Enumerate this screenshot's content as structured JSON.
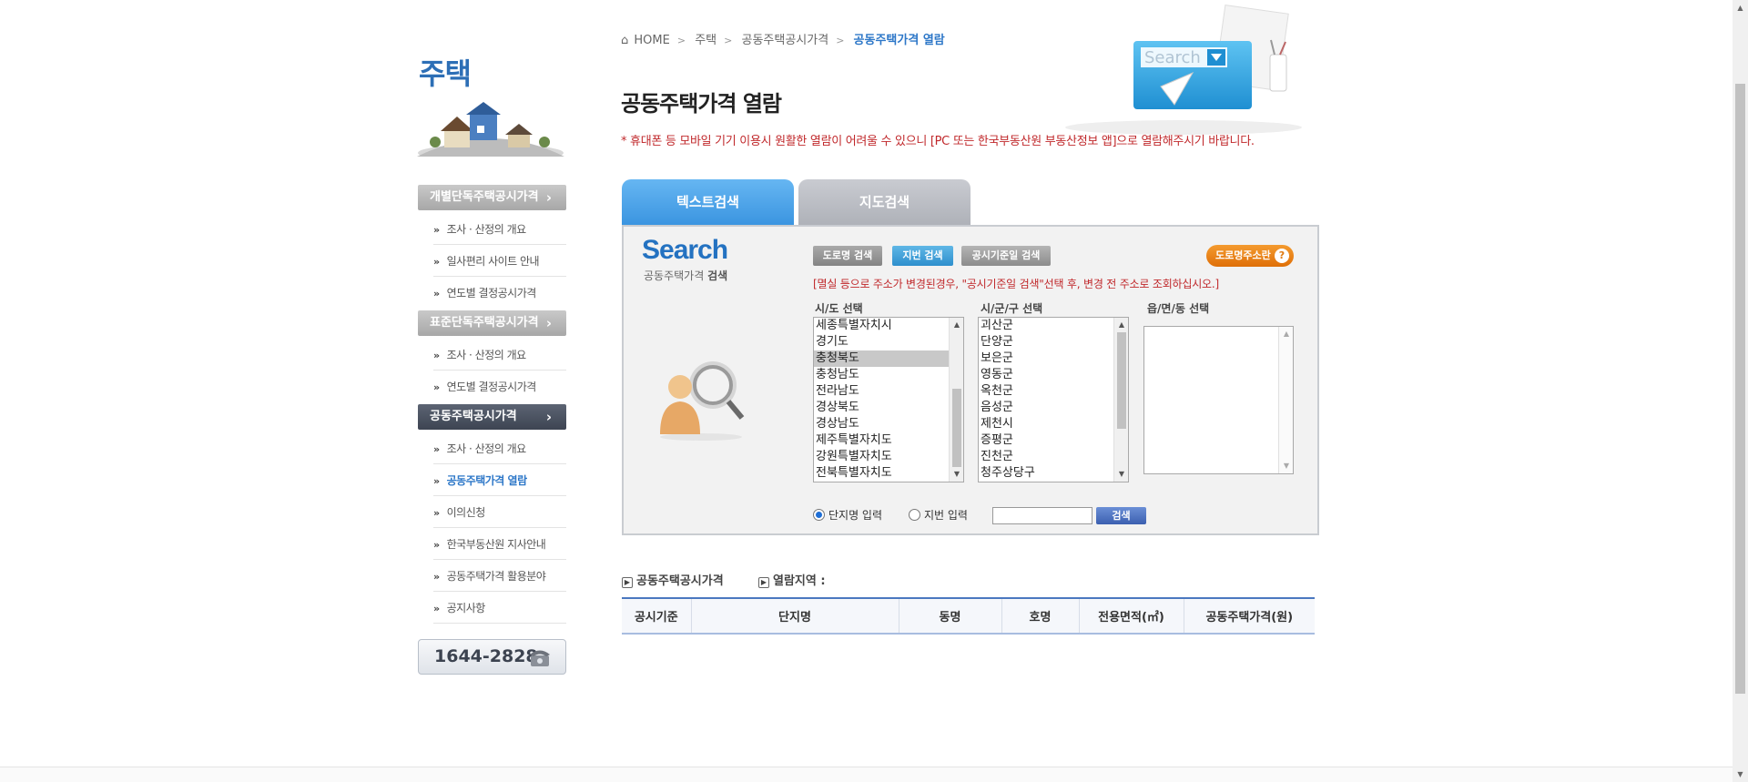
{
  "sidebar": {
    "title": "주택",
    "sections": [
      {
        "label": "개별단독주택공시가격",
        "items": [
          "조사 · 산정의 개요",
          "일사편리 사이트 안내",
          "연도별 결정공시가격"
        ]
      },
      {
        "label": "표준단독주택공시가격",
        "items": [
          "조사 · 산정의 개요",
          "연도별 결정공시가격"
        ]
      },
      {
        "label": "공동주택공시가격",
        "items": [
          "조사 · 산정의 개요",
          "공동주택가격 열람",
          "이의신청",
          "한국부동산원 지사안내",
          "공동주택가격 활용분야",
          "공지사항"
        ]
      }
    ],
    "bullet": "»",
    "chevron": "›",
    "phone": "1644-2828"
  },
  "breadcrumb": [
    "HOME",
    "주택",
    "공동주택공시가격",
    "공동주택가격 열람"
  ],
  "header_illus_text": "Search",
  "page": {
    "title": "공동주택가격 열람",
    "notice": "* 휴대폰 등 모바일 기기 이용시 원활한 열람이 어려울 수 있으니 [PC 또는 한국부동산원 부동산정보 앱]으로 열람해주시기 바랍니다."
  },
  "tabs": [
    "텍스트검색",
    "지도검색"
  ],
  "search": {
    "logo": "Search",
    "subtitle_plain": "공동주택가격 ",
    "subtitle_bold": "검색",
    "buttons": [
      "도로명 검색",
      "지번 검색",
      "공시기준일 검색"
    ],
    "guide_button": "도로명주소란",
    "guide_q": "?",
    "note": "[멸실 등으로 주소가 변경된경우, \"공시기준일 검색\"선택 후, 변경 전 주소로 조회하십시오.]",
    "col_labels": [
      "시/도 선택",
      "시/군/구 선택",
      "읍/면/동 선택"
    ],
    "sido_options": [
      "세종특별자치시",
      "경기도",
      "충청북도",
      "충청남도",
      "전라남도",
      "경상북도",
      "경상남도",
      "제주특별자치도",
      "강원특별자치도",
      "전북특별자치도"
    ],
    "sido_selected": "충청북도",
    "sigungu_options": [
      "괴산군",
      "단양군",
      "보은군",
      "영동군",
      "옥천군",
      "음성군",
      "제천시",
      "증평군",
      "진천군",
      "청주상당구"
    ],
    "radio_danji": "단지명 입력",
    "radio_jibun": "지번 입력",
    "input_value": "",
    "search_button": "검색"
  },
  "results": {
    "label_1": "공동주택공시가격",
    "label_2": "열람지역 :",
    "columns": [
      "공시기준",
      "단지명",
      "동명",
      "호명",
      "전용면적(㎡)",
      "공동주택가격(원)"
    ]
  },
  "colors": {
    "accent_blue": "#2d77c8",
    "notice_red": "#c0282b",
    "tab_active": "#3a94e0",
    "guide_orange": "#e87e10"
  }
}
